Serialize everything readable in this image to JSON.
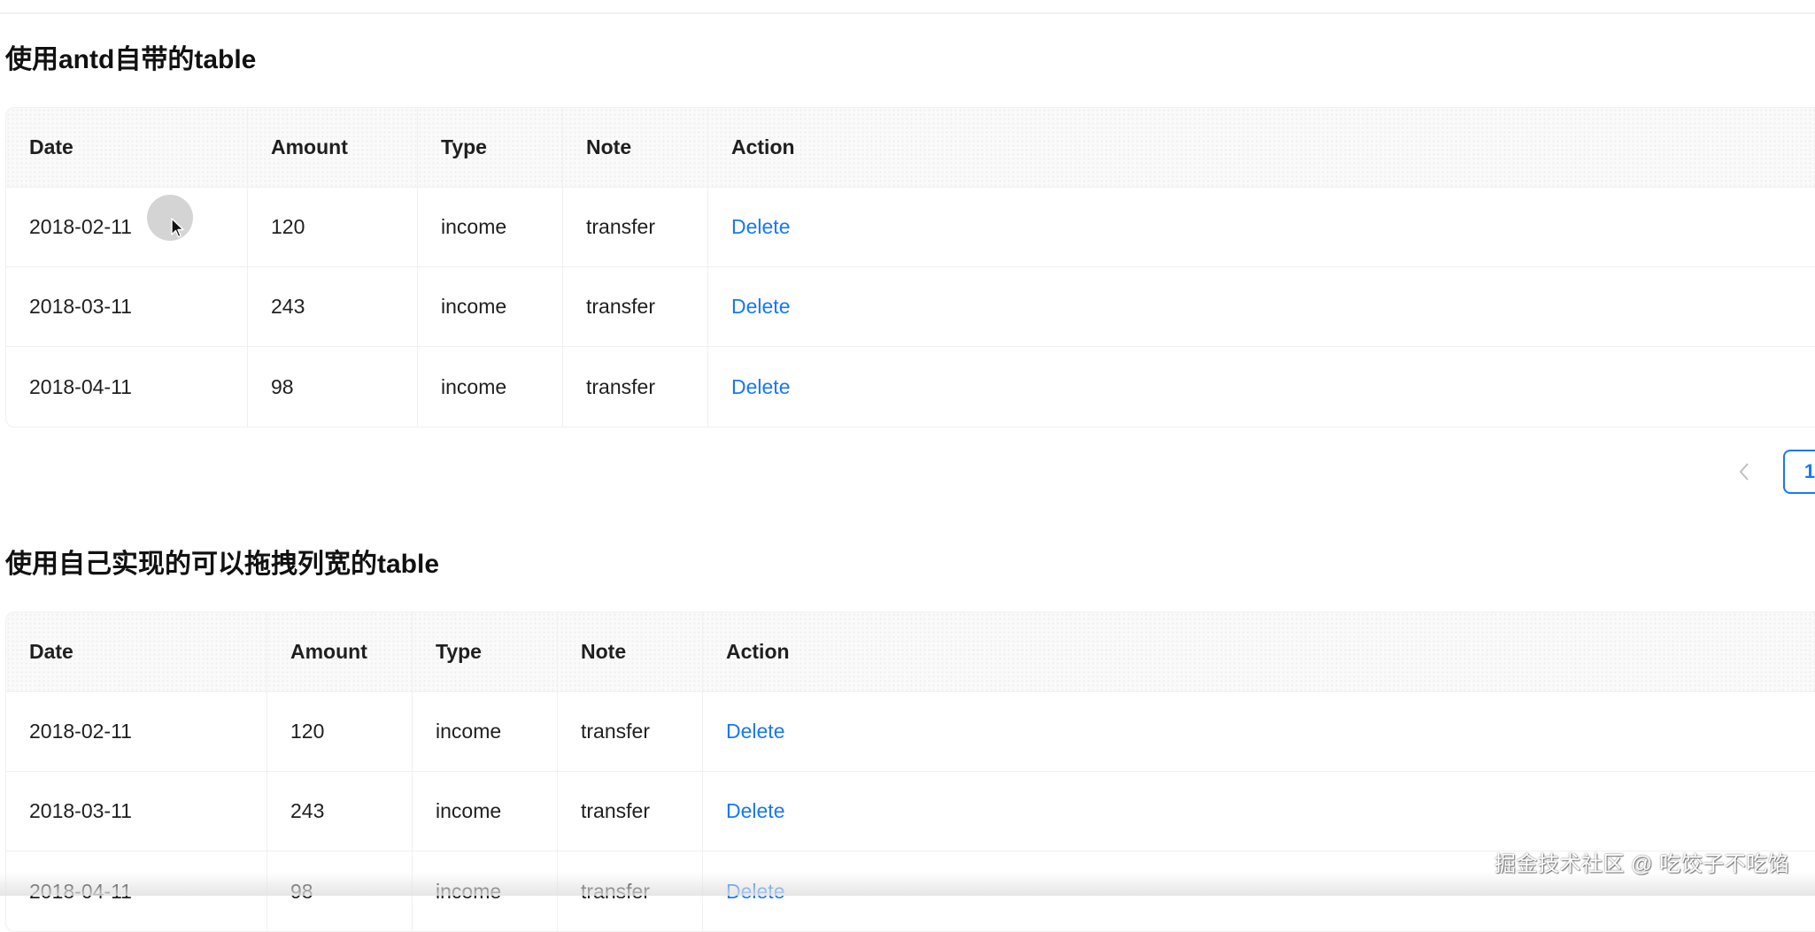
{
  "section1": {
    "title": "使用antd自带的table",
    "columns": [
      "Date",
      "Amount",
      "Type",
      "Note",
      "Action"
    ],
    "rows": [
      {
        "date": "2018-02-11",
        "amount": "120",
        "type": "income",
        "note": "transfer",
        "action": "Delete"
      },
      {
        "date": "2018-03-11",
        "amount": "243",
        "type": "income",
        "note": "transfer",
        "action": "Delete"
      },
      {
        "date": "2018-04-11",
        "amount": "98",
        "type": "income",
        "note": "transfer",
        "action": "Delete"
      }
    ]
  },
  "pagination": {
    "prev_icon": "chevron-left-icon",
    "current_page": "1"
  },
  "section2": {
    "title": "使用自己实现的可以拖拽列宽的table",
    "columns": [
      "Date",
      "Amount",
      "Type",
      "Note",
      "Action"
    ],
    "rows": [
      {
        "date": "2018-02-11",
        "amount": "120",
        "type": "income",
        "note": "transfer",
        "action": "Delete"
      },
      {
        "date": "2018-03-11",
        "amount": "243",
        "type": "income",
        "note": "transfer",
        "action": "Delete"
      },
      {
        "date": "2018-04-11",
        "amount": "98",
        "type": "income",
        "note": "transfer",
        "action": "Delete"
      }
    ]
  },
  "watermark": "掘金技术社区 @ 吃饺子不吃馅",
  "colors": {
    "link": "#1677ff",
    "header_bg": "#fafafa",
    "border": "#f0f0f0"
  }
}
